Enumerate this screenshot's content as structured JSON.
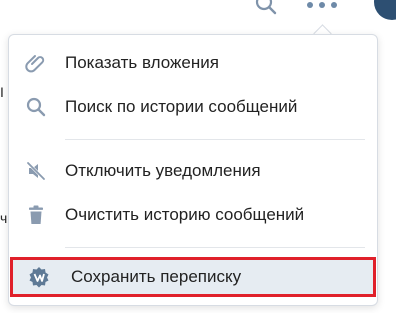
{
  "menu": {
    "items": [
      {
        "label": "Показать вложения",
        "icon": "paperclip-icon"
      },
      {
        "label": "Поиск по истории сообщений",
        "icon": "search-icon"
      },
      {
        "label": "Отключить уведомления",
        "icon": "speaker-mute-icon"
      },
      {
        "label": "Очистить историю сообщений",
        "icon": "trash-icon"
      },
      {
        "label": "Сохранить переписку",
        "icon": "save-badge-icon"
      }
    ]
  },
  "background": {
    "fragment_1": "I",
    "fragment_2": "ч"
  },
  "colors": {
    "icon": "#8a9bb0",
    "text": "#222222",
    "highlight_bg": "#e6ecf2",
    "highlight_border": "#e0202a",
    "accent_dark": "#2d4f72"
  }
}
